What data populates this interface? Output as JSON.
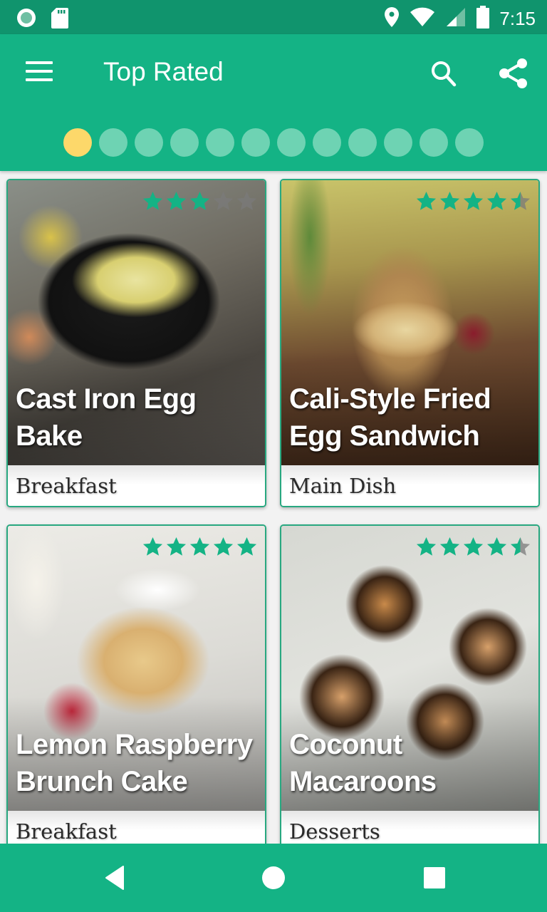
{
  "status_bar": {
    "time": "7:15",
    "left_icons": [
      "record-icon",
      "sd-card-icon"
    ],
    "right_icons": [
      "location-icon",
      "wifi-icon",
      "cell-signal-icon",
      "battery-icon"
    ]
  },
  "app_bar": {
    "title": "Top Rated",
    "menu_icon": "hamburger-menu-icon",
    "actions": [
      "search-icon",
      "share-icon"
    ]
  },
  "pager": {
    "total_pages": 12,
    "active_index": 0,
    "colors": {
      "active": "#fdd86a",
      "inactive": "#6ed3b3"
    }
  },
  "theme": {
    "status_bar": "#10946d",
    "primary": "#14b385",
    "card_border": "#28a880",
    "star_filled": "#14b385",
    "star_empty": "#7a7a7a"
  },
  "recipes": [
    {
      "title": "Cast Iron Egg Bake",
      "category": "Breakfast",
      "rating": 3,
      "max_rating": 5
    },
    {
      "title": "Cali-Style Fried Egg Sandwich",
      "category": "Main Dish",
      "rating": 4.5,
      "max_rating": 5
    },
    {
      "title": "Lemon Raspberry Brunch Cake",
      "category": "Breakfast",
      "rating": 5,
      "max_rating": 5
    },
    {
      "title": "Coconut Macaroons",
      "category": "Desserts",
      "rating": 4.5,
      "max_rating": 5
    }
  ],
  "nav_bar": {
    "buttons": [
      "back",
      "home",
      "recents"
    ]
  }
}
